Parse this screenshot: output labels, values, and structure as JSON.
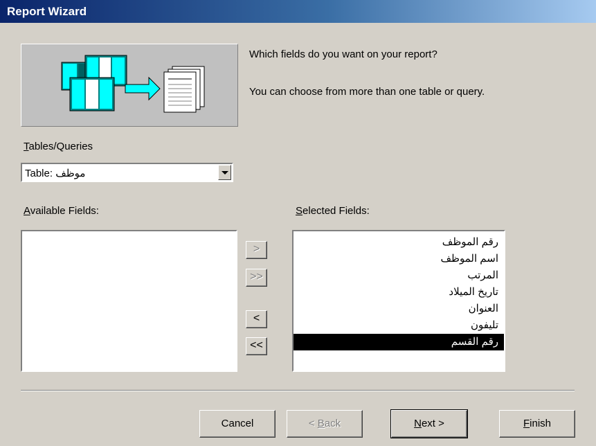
{
  "window": {
    "title": "Report Wizard"
  },
  "prompt": {
    "line1": "Which fields do you want on your report?",
    "line2": "You can choose from more than one table or query."
  },
  "tables_queries": {
    "label_accel": "T",
    "label_rest": "ables/Queries",
    "value": "Table: موظف"
  },
  "available_fields": {
    "label_accel": "A",
    "label_rest": "vailable Fields:",
    "items": []
  },
  "selected_fields": {
    "label_accel": "S",
    "label_rest": "elected Fields:",
    "items": [
      "رقم الموظف",
      "اسم الموظف",
      "المرتب",
      "تاريخ الميلاد",
      "العنوان",
      "تليفون",
      "رقم القسم"
    ],
    "selected_index": 6
  },
  "move_buttons": {
    "add_one": ">",
    "add_all": ">>",
    "remove_one": "<",
    "remove_all": "<<"
  },
  "footer": {
    "cancel": "Cancel",
    "back_accel": "B",
    "back_pre": "< ",
    "back_rest": "ack",
    "next_accel": "N",
    "next_rest": "ext >",
    "finish_accel": "F",
    "finish_rest": "inish"
  },
  "colors": {
    "title_start": "#0a246a",
    "title_end": "#a6caf0",
    "face": "#d4d0c8",
    "arrow": "#00ffff",
    "table": "#008080"
  },
  "icons": [
    "tables-icon",
    "arrow-right-icon",
    "report-pages-icon",
    "dropdown-arrow-icon"
  ]
}
